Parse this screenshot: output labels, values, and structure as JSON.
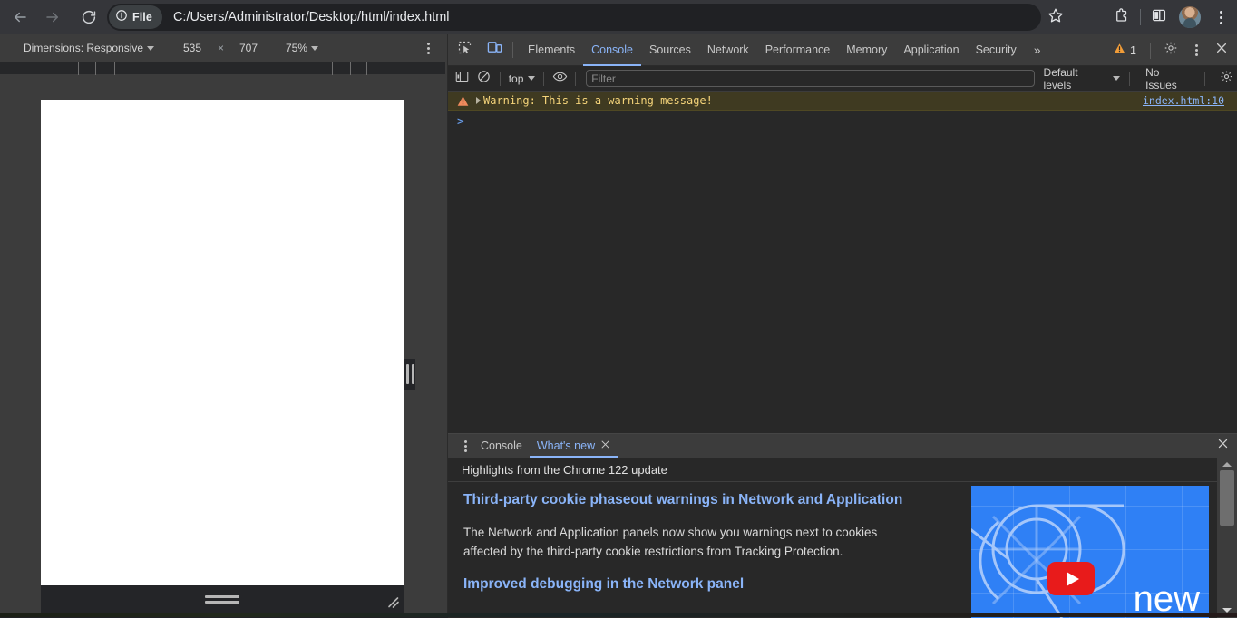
{
  "browser": {
    "nav": {
      "back": "back-arrow",
      "forward": "forward-arrow",
      "reload": "reload"
    },
    "omnibox": {
      "chip_label": "File",
      "chip_icon": "info-circle-icon",
      "url": "C:/Users/Administrator/Desktop/html/index.html"
    },
    "actions": [
      "bookmark-star",
      "extensions-puzzle",
      "side-panel",
      "profile-avatar",
      "chrome-menu"
    ]
  },
  "device_toolbar": {
    "dimensions_label": "Dimensions: Responsive",
    "width": "535",
    "times": "×",
    "height": "707",
    "zoom": "75%",
    "more_label": "more-options"
  },
  "devtools": {
    "tabs": [
      {
        "label": "Elements",
        "active": false
      },
      {
        "label": "Console",
        "active": true
      },
      {
        "label": "Sources",
        "active": false
      },
      {
        "label": "Network",
        "active": false
      },
      {
        "label": "Performance",
        "active": false
      },
      {
        "label": "Memory",
        "active": false
      },
      {
        "label": "Application",
        "active": false
      },
      {
        "label": "Security",
        "active": false
      }
    ],
    "overflow": "»",
    "warning_count": "1",
    "filter_bar": {
      "context": "top",
      "filter_placeholder": "Filter",
      "filter_value": "",
      "levels": "Default levels",
      "issues": "No Issues"
    },
    "console": {
      "messages": [
        {
          "severity": "warning",
          "text": "Warning: This is a warning message!",
          "source": "index.html:10"
        }
      ],
      "prompt": ">"
    }
  },
  "drawer": {
    "tabs": [
      {
        "label": "Console",
        "active": false,
        "closable": false
      },
      {
        "label": "What's new",
        "active": true,
        "closable": true
      }
    ],
    "subtitle": "Highlights from the Chrome 122 update",
    "entries": [
      {
        "heading": "Third-party cookie phaseout warnings in Network and Application",
        "body": "The Network and Application panels now show you warnings next to cookies affected by the third-party cookie restrictions from Tracking Protection."
      },
      {
        "heading": "Improved debugging in the Network panel",
        "body": ""
      }
    ],
    "thumbnail_label": "new",
    "thumbnail_play": "youtube-play-icon"
  },
  "colors": {
    "accent_blue": "#8ab4f8",
    "warning_bg": "#3f3a21",
    "warning_text": "#f5d47a",
    "chrome_bg": "#35363a",
    "devtools_bg": "#282828",
    "toolbar_bg": "#3c3c3c",
    "youtube_red": "#e81b1b",
    "thumb_blue": "#2f80f5"
  }
}
